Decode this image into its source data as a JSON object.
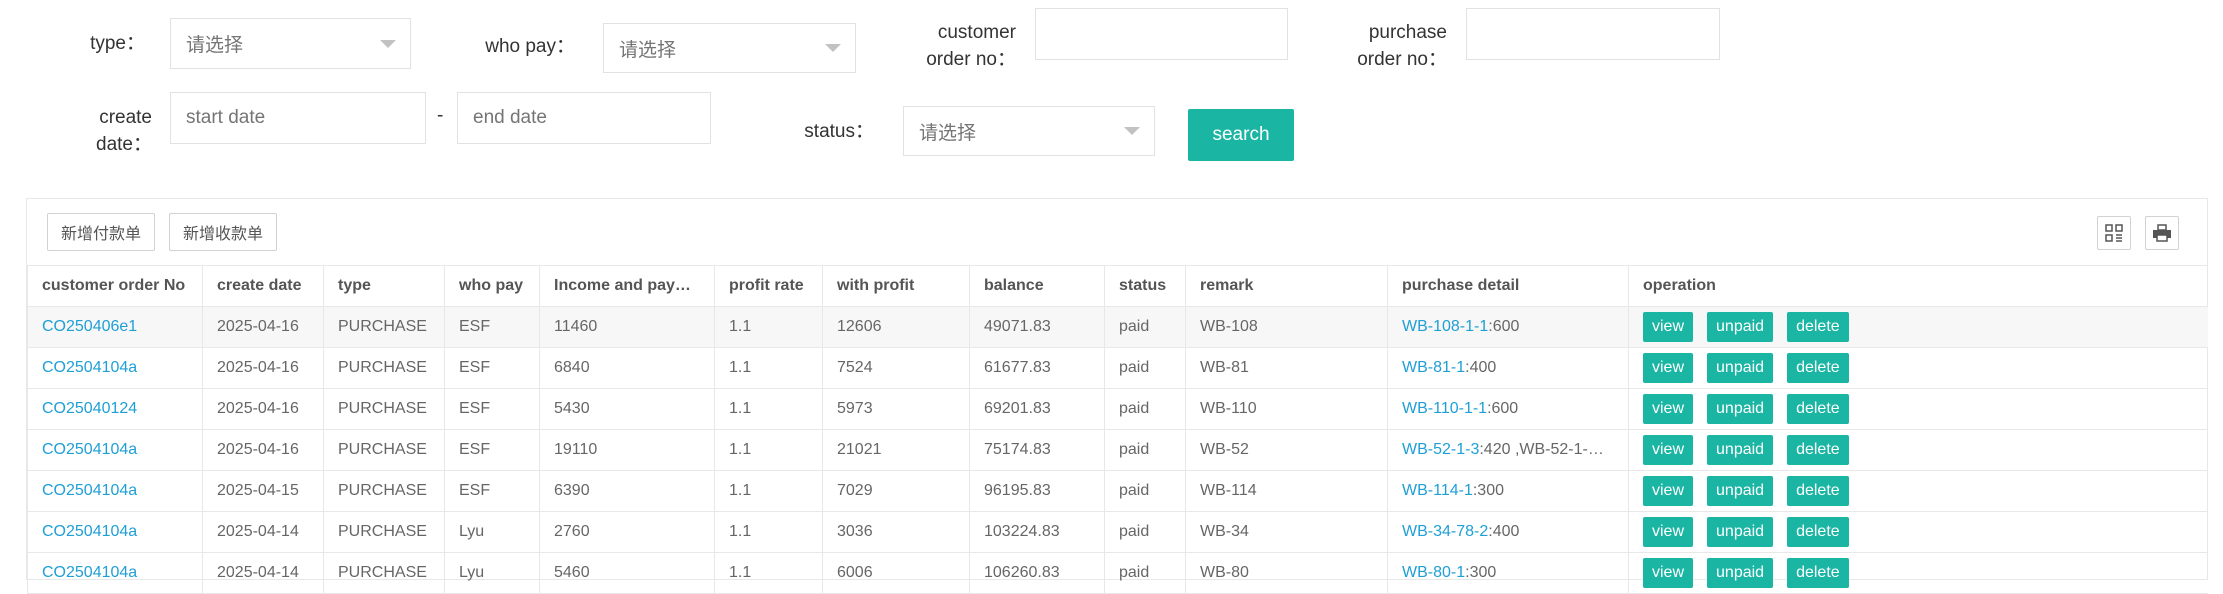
{
  "filters": {
    "type_label": "type：",
    "type_value": "请选择",
    "who_pay_label": "who pay：",
    "who_pay_value": "请选择",
    "customer_order_label_1": "customer",
    "customer_order_label_2": "order no：",
    "customer_order_value": "",
    "purchase_order_label_1": "purchase",
    "purchase_order_label_2": "order no：",
    "purchase_order_value": "",
    "create_date_label_1": "create",
    "create_date_label_2": "date：",
    "start_date_placeholder": "start date",
    "date_separator": "-",
    "end_date_placeholder": "end date",
    "status_label": "status：",
    "status_value": "请选择",
    "search_label": "search"
  },
  "toolbar": {
    "add_payment_label": "新增付款单",
    "add_receipt_label": "新增收款单",
    "columns_icon": "columns-icon",
    "print_icon": "print-icon"
  },
  "table": {
    "columns": [
      "customer order No",
      "create date",
      "type",
      "who pay",
      "Income and pay…",
      "profit rate",
      "with profit",
      "balance",
      "status",
      "remark",
      "purchase detail",
      "operation"
    ],
    "rows": [
      {
        "order": "CO250406e1",
        "date": "2025-04-16",
        "type": "PURCHASE",
        "who": "ESF",
        "income": "11460",
        "rate": "1.1",
        "profit": "12606",
        "balance": "49071.83",
        "status": "paid",
        "remark": "WB-108",
        "detail_link": "WB-108-1-1",
        "detail_qty": ":600"
      },
      {
        "order": "CO2504104a",
        "date": "2025-04-16",
        "type": "PURCHASE",
        "who": "ESF",
        "income": "6840",
        "rate": "1.1",
        "profit": "7524",
        "balance": "61677.83",
        "status": "paid",
        "remark": "WB-81",
        "detail_link": "WB-81-1",
        "detail_qty": ":400"
      },
      {
        "order": "CO25040124",
        "date": "2025-04-16",
        "type": "PURCHASE",
        "who": "ESF",
        "income": "5430",
        "rate": "1.1",
        "profit": "5973",
        "balance": "69201.83",
        "status": "paid",
        "remark": "WB-110",
        "detail_link": "WB-110-1-1",
        "detail_qty": ":600"
      },
      {
        "order": "CO2504104a",
        "date": "2025-04-16",
        "type": "PURCHASE",
        "who": "ESF",
        "income": "19110",
        "rate": "1.1",
        "profit": "21021",
        "balance": "75174.83",
        "status": "paid",
        "remark": "WB-52",
        "detail_link": "WB-52-1-3",
        "detail_qty": ":420 ,WB-52-1-…"
      },
      {
        "order": "CO2504104a",
        "date": "2025-04-15",
        "type": "PURCHASE",
        "who": "ESF",
        "income": "6390",
        "rate": "1.1",
        "profit": "7029",
        "balance": "96195.83",
        "status": "paid",
        "remark": "WB-114",
        "detail_link": "WB-114-1",
        "detail_qty": ":300"
      },
      {
        "order": "CO2504104a",
        "date": "2025-04-14",
        "type": "PURCHASE",
        "who": "Lyu",
        "income": "2760",
        "rate": "1.1",
        "profit": "3036",
        "balance": "103224.83",
        "status": "paid",
        "remark": "WB-34",
        "detail_link": "WB-34-78-2",
        "detail_qty": ":400"
      },
      {
        "order": "CO2504104a",
        "date": "2025-04-14",
        "type": "PURCHASE",
        "who": "Lyu",
        "income": "5460",
        "rate": "1.1",
        "profit": "6006",
        "balance": "106260.83",
        "status": "paid",
        "remark": "WB-80",
        "detail_link": "WB-80-1",
        "detail_qty": ":300"
      }
    ],
    "actions": {
      "view": "view",
      "unpaid": "unpaid",
      "delete": "delete"
    }
  },
  "colors": {
    "accent": "#1ab5a3",
    "link": "#1e9fd6"
  }
}
